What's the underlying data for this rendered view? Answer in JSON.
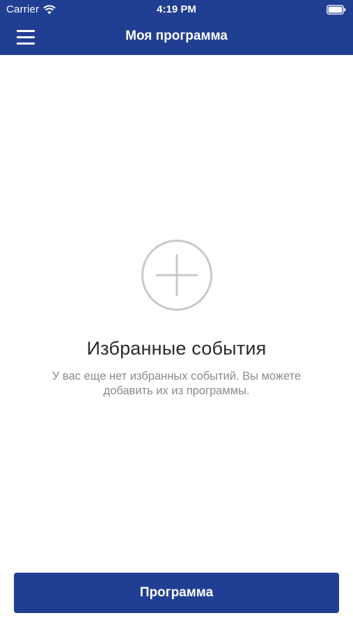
{
  "status_bar": {
    "carrier": "Carrier",
    "time": "4:19 PM",
    "wifi_icon": "wifi-icon",
    "battery_icon": "battery-icon"
  },
  "nav": {
    "title": "Моя программа",
    "menu_icon": "hamburger-menu-icon"
  },
  "empty_state": {
    "icon": "add-circle-icon",
    "title": "Избранные события",
    "line1": "У вас еще нет избранных событий. Вы можете",
    "line2": "добавить их из программы."
  },
  "footer": {
    "button_label": "Программа"
  },
  "colors": {
    "brand": "#213f92",
    "icon_gray": "#c8c8c8",
    "text_gray": "#8b8b8b"
  }
}
